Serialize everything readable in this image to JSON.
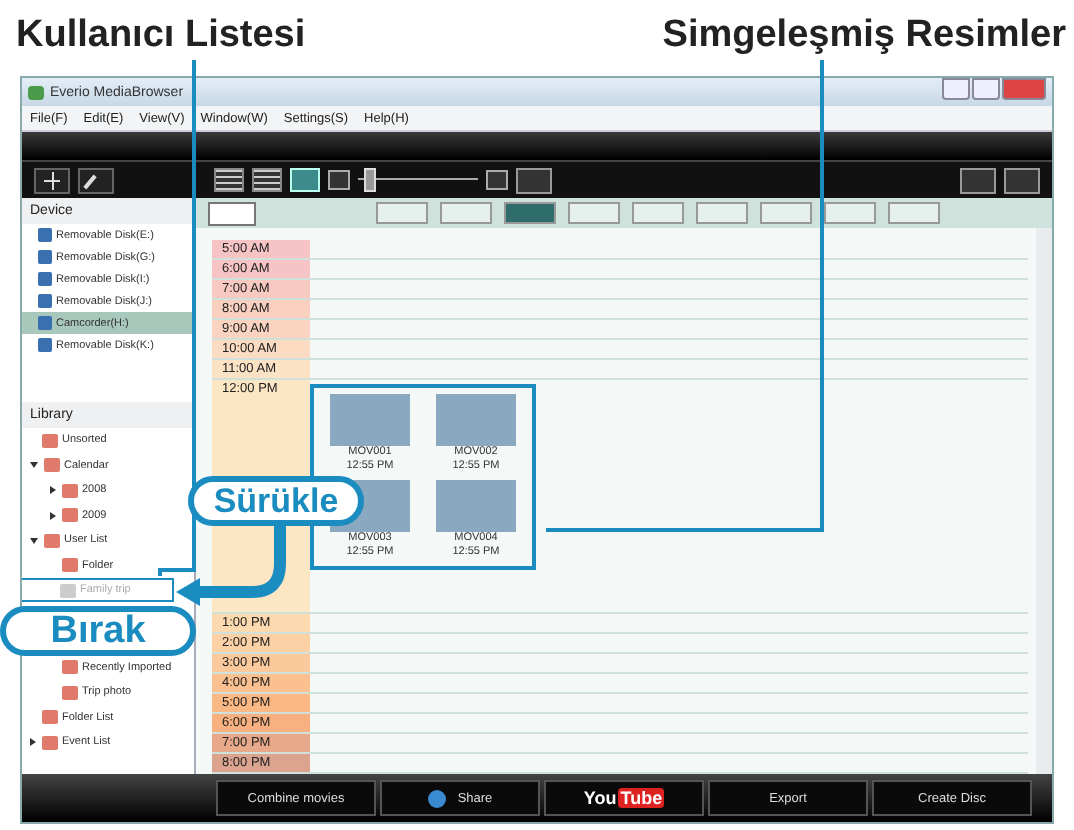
{
  "callouts": {
    "user_list": "Kullanıcı Listesi",
    "thumbnails": "Simgeleşmiş Resimler"
  },
  "window": {
    "title": "Everio MediaBrowser"
  },
  "menu": [
    "File(F)",
    "Edit(E)",
    "View(V)",
    "Window(W)",
    "Settings(S)",
    "Help(H)"
  ],
  "view_modes": [
    {
      "selected": false
    },
    {
      "selected": false
    },
    {
      "selected": true
    }
  ],
  "zoom_slider": {
    "level": 0.05
  },
  "nav_buttons": [
    {
      "selected": false
    },
    {
      "selected": false
    },
    {
      "selected": true
    },
    {
      "selected": false
    },
    {
      "selected": false
    },
    {
      "selected": false
    },
    {
      "selected": false
    },
    {
      "selected": false
    },
    {
      "selected": false
    }
  ],
  "sidebar": {
    "device_header": "Device",
    "devices": [
      {
        "label": "Removable Disk(E:)",
        "selected": false
      },
      {
        "label": "Removable Disk(G:)",
        "selected": false
      },
      {
        "label": "Removable Disk(I:)",
        "selected": false
      },
      {
        "label": "Removable Disk(J:)",
        "selected": false
      },
      {
        "label": "Camcorder(H:)",
        "selected": true
      },
      {
        "label": "Removable Disk(K:)",
        "selected": false
      }
    ],
    "library_header": "Library",
    "library": [
      {
        "label": "Unsorted",
        "dimmed": false
      },
      {
        "label": "Calendar",
        "dimmed": false,
        "expanded": true,
        "children": [
          {
            "label": "2008",
            "dimmed": false,
            "expanded": false
          },
          {
            "label": "2009",
            "dimmed": false,
            "expanded": false
          }
        ]
      },
      {
        "label": "User List",
        "dimmed": false,
        "expanded": true,
        "children": [
          {
            "label": "Folder",
            "dimmed": false
          },
          {
            "label": "Family trip",
            "dimmed": true
          },
          {
            "label": "Recently Imported",
            "dimmed": false
          },
          {
            "label": "Trip photo",
            "dimmed": false
          }
        ]
      },
      {
        "label": "Folder List",
        "dimmed": false
      },
      {
        "label": "Event List",
        "dimmed": false,
        "expanded": false
      }
    ]
  },
  "calendar": {
    "rows": [
      {
        "time": "5:00 AM",
        "color": "#f7c4c6"
      },
      {
        "time": "6:00 AM",
        "color": "#f7c4c6"
      },
      {
        "time": "7:00 AM",
        "color": "#f8c9c0"
      },
      {
        "time": "8:00 AM",
        "color": "#f9cfc0"
      },
      {
        "time": "9:00 AM",
        "color": "#fad4c0"
      },
      {
        "time": "10:00 AM",
        "color": "#fbdcc2"
      },
      {
        "time": "11:00 AM",
        "color": "#fce2c4"
      },
      {
        "time": "12:00 PM",
        "color": "#fde6c4",
        "thumbnails": [
          {
            "name": "MOV001",
            "time": "12:55 PM"
          },
          {
            "name": "MOV002",
            "time": "12:55 PM"
          },
          {
            "name": "MOV003",
            "time": "12:55 PM"
          },
          {
            "name": "MOV004",
            "time": "12:55 PM"
          }
        ]
      },
      {
        "time": "1:00 PM",
        "color": "#fdd9b0"
      },
      {
        "time": "2:00 PM",
        "color": "#fcd1a6"
      },
      {
        "time": "3:00 PM",
        "color": "#fcc99c"
      },
      {
        "time": "4:00 PM",
        "color": "#fbc08f"
      },
      {
        "time": "5:00 PM",
        "color": "#fab885"
      },
      {
        "time": "6:00 PM",
        "color": "#f8b080"
      },
      {
        "time": "7:00 PM",
        "color": "#e8a88a"
      },
      {
        "time": "8:00 PM",
        "color": "#dca48e"
      }
    ]
  },
  "bottom_bar": [
    {
      "kind": "text",
      "label": "Combine movies"
    },
    {
      "kind": "share",
      "label": "Share"
    },
    {
      "kind": "youtube",
      "label": "You",
      "label_2": "Tube"
    },
    {
      "kind": "text",
      "label": "Export"
    },
    {
      "kind": "text",
      "label": "Create Disc"
    }
  ],
  "drag_label": "Sürükle",
  "drop_label": "Bırak"
}
